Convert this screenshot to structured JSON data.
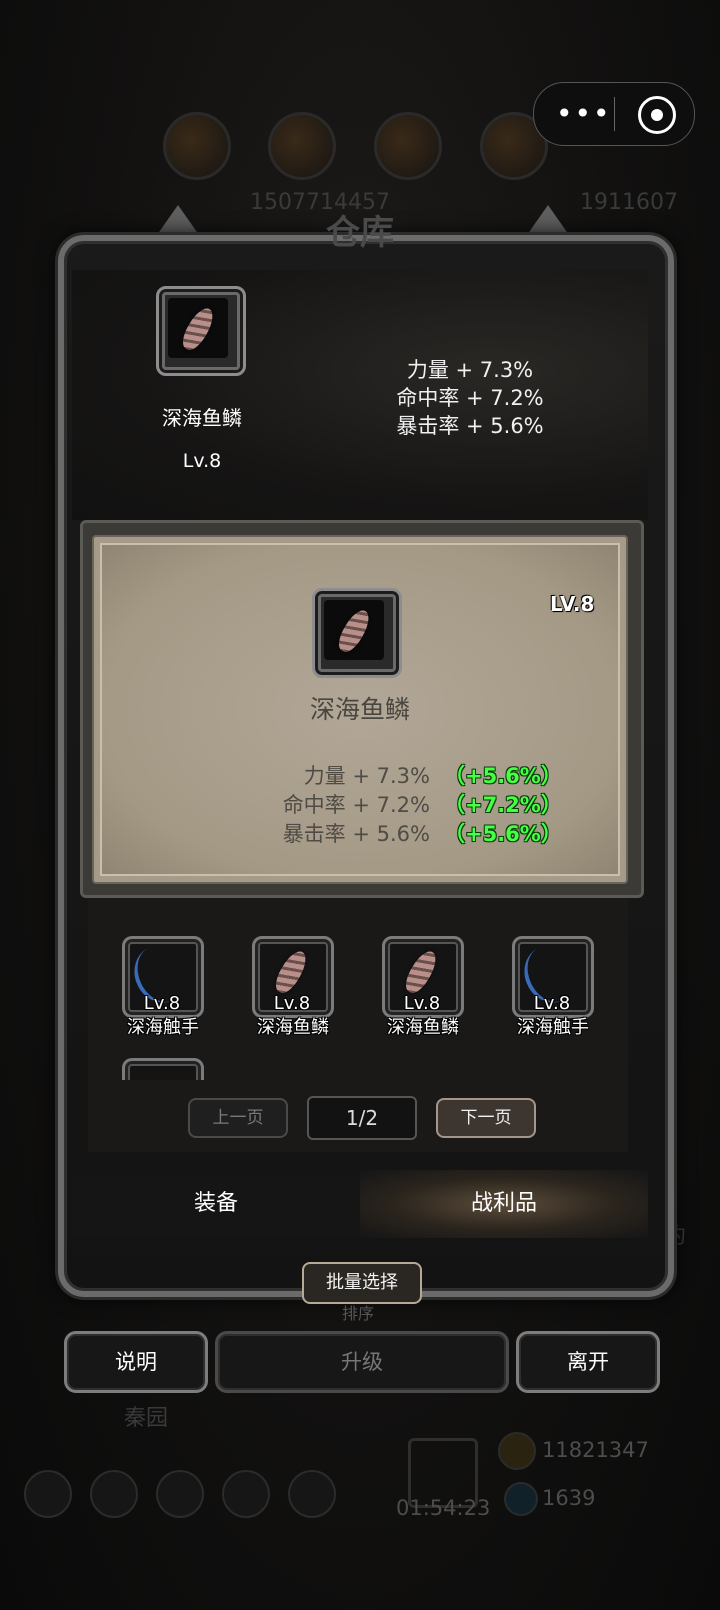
{
  "capsule": {
    "more_icon": "more-dots-icon",
    "close_icon": "target-close-icon"
  },
  "background": {
    "numbers_top": [
      "1507714457",
      "1911607"
    ],
    "label_right": "约",
    "label_bottom_left": "秦园",
    "timer": "01:54:23",
    "currency_1": "11821347",
    "currency_2": "1639"
  },
  "panel": {
    "title": "仓库"
  },
  "equipped": {
    "icon": "deep-sea-scale-icon",
    "name": "深海鱼鳞",
    "level": "Lv.8",
    "stats": [
      "力量 + 7.3%",
      "命中率 + 7.2%",
      "暴击率 + 5.6%"
    ]
  },
  "detail": {
    "level": "LV.8",
    "icon": "deep-sea-scale-icon",
    "name": "深海鱼鳞",
    "stats": [
      {
        "label": "力量 + 7.3%",
        "bonus": "（+5.6%）"
      },
      {
        "label": "命中率 + 7.2%",
        "bonus": "（+7.2%）"
      },
      {
        "label": "暴击率 + 5.6%",
        "bonus": "（+5.6%）"
      }
    ]
  },
  "items": [
    {
      "name": "深海触手",
      "level": "Lv.8",
      "icon": "tentacle-icon"
    },
    {
      "name": "深海鱼鳞",
      "level": "Lv.8",
      "icon": "scale-icon"
    },
    {
      "name": "深海鱼鳞",
      "level": "Lv.8",
      "icon": "scale-icon"
    },
    {
      "name": "深海触手",
      "level": "Lv.8",
      "icon": "tentacle-icon"
    }
  ],
  "pagination": {
    "prev": "上一页",
    "page": "1/2",
    "next": "下一页"
  },
  "tabs": {
    "equipment": "装备",
    "loot": "战利品"
  },
  "batch_select": "批量选择",
  "sort": "排序",
  "buttons": {
    "help": "说明",
    "upgrade": "升级",
    "leave": "离开"
  }
}
